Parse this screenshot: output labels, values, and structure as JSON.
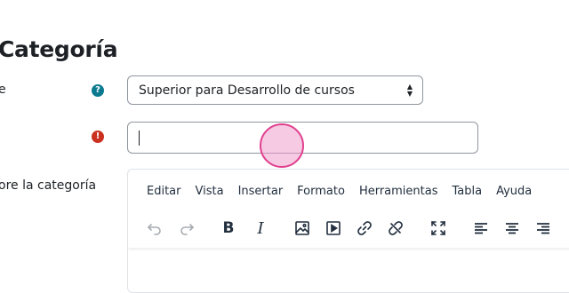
{
  "page": {
    "title": "Categoría"
  },
  "form": {
    "parent": {
      "label": "e",
      "selected": "Superior para Desarrollo de cursos",
      "help_icon_glyph": "?"
    },
    "name": {
      "label": "",
      "value": "",
      "required_icon_glyph": "!"
    },
    "description": {
      "label": "ore la categoría"
    }
  },
  "editor": {
    "menus": [
      "Editar",
      "Vista",
      "Insertar",
      "Formato",
      "Herramientas",
      "Tabla",
      "Ayuda"
    ],
    "toolbar": {
      "bold_label": "B",
      "italic_label": "I",
      "icons": [
        "undo-icon",
        "redo-icon",
        "bold-icon",
        "italic-icon",
        "image-icon",
        "media-icon",
        "link-icon",
        "unlink-icon",
        "fullscreen-icon",
        "align-left-icon",
        "align-center-icon",
        "align-right-icon"
      ]
    }
  },
  "colors": {
    "help": "#0b7a8f",
    "required": "#ca3120",
    "click_marker": "#e0408f"
  }
}
